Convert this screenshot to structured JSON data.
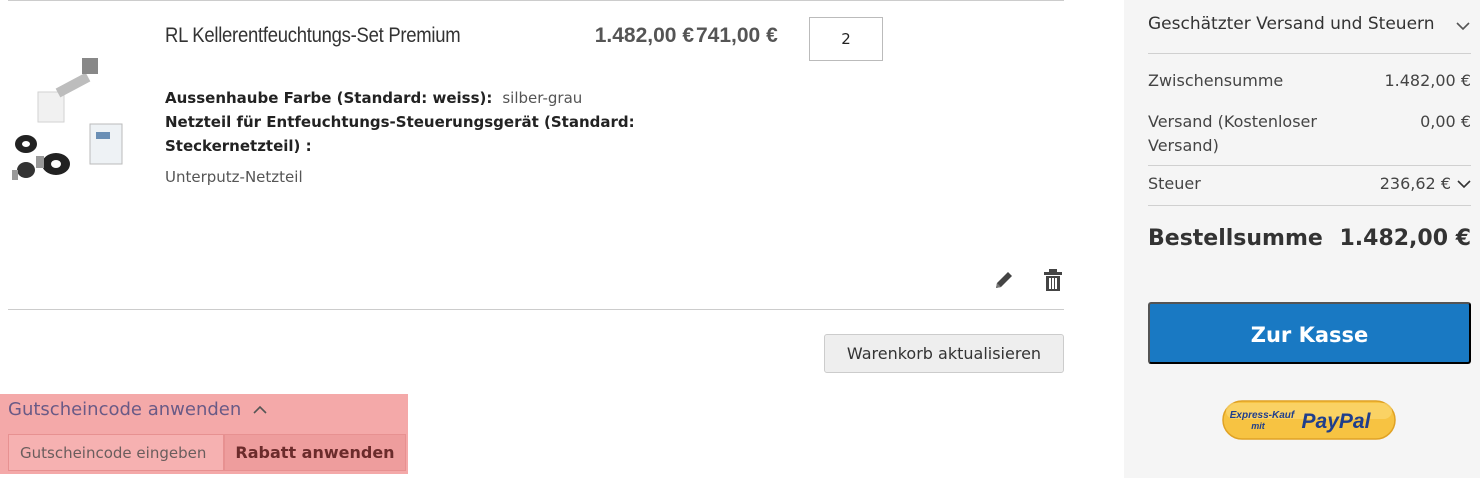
{
  "cart": {
    "item": {
      "name": "RL Kellerentfeuchtungs-Set Premium",
      "unit_price": "741,00 €",
      "quantity": "2",
      "subtotal": "1.482,00 €",
      "options": [
        {
          "label": "Aussenhaube Farbe (Standard: weiss):",
          "value": "silber-grau"
        },
        {
          "label": "Netzteil für Entfeuchtungs-Steuerungsgerät (Standard: Steckernetzteil) :",
          "value": "Unterputz-Netzteil"
        }
      ]
    },
    "update_button": "Warenkorb aktualisieren",
    "coupon": {
      "title": "Gutscheincode anwenden",
      "placeholder": "Gutscheincode eingeben",
      "apply_button": "Rabatt anwenden"
    }
  },
  "summary": {
    "shipping_estimate": "Geschätzter Versand und Steuern",
    "rows": [
      {
        "label": "Zwischensumme",
        "value": "1.482,00 €"
      },
      {
        "label": "Versand (Kostenloser Versand)",
        "value": "0,00 €"
      },
      {
        "label": "Steuer",
        "value": "236,62 €"
      }
    ],
    "total_label": "Bestellsumme",
    "total_value": "1.482,00 €",
    "checkout_button": "Zur Kasse",
    "paypal": {
      "line1": "Express-Kauf",
      "line2": "mit",
      "brand": "PayPal"
    }
  },
  "colors": {
    "checkout": "#1979c3",
    "coupon_highlight": "#f4a9a9",
    "paypal_gold": "#f7c342",
    "paypal_blue": "#1f3e8c"
  },
  "icons": [
    "pencil-icon",
    "trash-icon",
    "chevron-up-icon",
    "chevron-down-icon"
  ]
}
